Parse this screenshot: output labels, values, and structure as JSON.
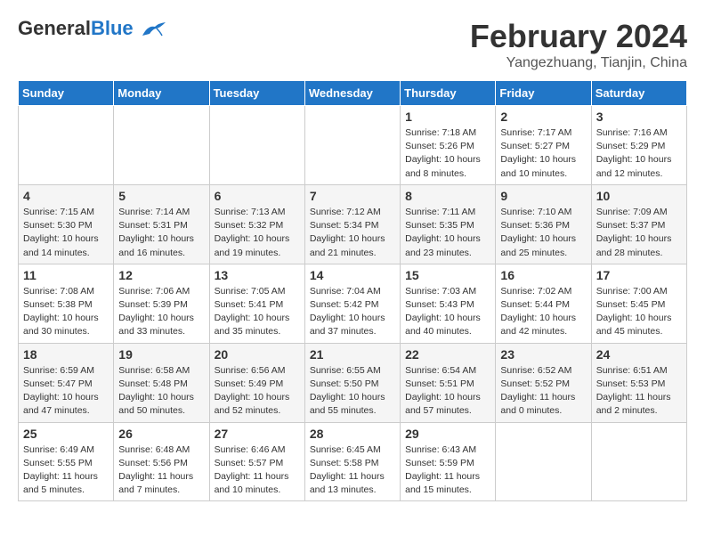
{
  "header": {
    "logo_line1": "General",
    "logo_line2": "Blue",
    "month_year": "February 2024",
    "location": "Yangezhuang, Tianjin, China"
  },
  "days_of_week": [
    "Sunday",
    "Monday",
    "Tuesday",
    "Wednesday",
    "Thursday",
    "Friday",
    "Saturday"
  ],
  "weeks": [
    [
      {
        "day": "",
        "info": ""
      },
      {
        "day": "",
        "info": ""
      },
      {
        "day": "",
        "info": ""
      },
      {
        "day": "",
        "info": ""
      },
      {
        "day": "1",
        "info": "Sunrise: 7:18 AM\nSunset: 5:26 PM\nDaylight: 10 hours\nand 8 minutes."
      },
      {
        "day": "2",
        "info": "Sunrise: 7:17 AM\nSunset: 5:27 PM\nDaylight: 10 hours\nand 10 minutes."
      },
      {
        "day": "3",
        "info": "Sunrise: 7:16 AM\nSunset: 5:29 PM\nDaylight: 10 hours\nand 12 minutes."
      }
    ],
    [
      {
        "day": "4",
        "info": "Sunrise: 7:15 AM\nSunset: 5:30 PM\nDaylight: 10 hours\nand 14 minutes."
      },
      {
        "day": "5",
        "info": "Sunrise: 7:14 AM\nSunset: 5:31 PM\nDaylight: 10 hours\nand 16 minutes."
      },
      {
        "day": "6",
        "info": "Sunrise: 7:13 AM\nSunset: 5:32 PM\nDaylight: 10 hours\nand 19 minutes."
      },
      {
        "day": "7",
        "info": "Sunrise: 7:12 AM\nSunset: 5:34 PM\nDaylight: 10 hours\nand 21 minutes."
      },
      {
        "day": "8",
        "info": "Sunrise: 7:11 AM\nSunset: 5:35 PM\nDaylight: 10 hours\nand 23 minutes."
      },
      {
        "day": "9",
        "info": "Sunrise: 7:10 AM\nSunset: 5:36 PM\nDaylight: 10 hours\nand 25 minutes."
      },
      {
        "day": "10",
        "info": "Sunrise: 7:09 AM\nSunset: 5:37 PM\nDaylight: 10 hours\nand 28 minutes."
      }
    ],
    [
      {
        "day": "11",
        "info": "Sunrise: 7:08 AM\nSunset: 5:38 PM\nDaylight: 10 hours\nand 30 minutes."
      },
      {
        "day": "12",
        "info": "Sunrise: 7:06 AM\nSunset: 5:39 PM\nDaylight: 10 hours\nand 33 minutes."
      },
      {
        "day": "13",
        "info": "Sunrise: 7:05 AM\nSunset: 5:41 PM\nDaylight: 10 hours\nand 35 minutes."
      },
      {
        "day": "14",
        "info": "Sunrise: 7:04 AM\nSunset: 5:42 PM\nDaylight: 10 hours\nand 37 minutes."
      },
      {
        "day": "15",
        "info": "Sunrise: 7:03 AM\nSunset: 5:43 PM\nDaylight: 10 hours\nand 40 minutes."
      },
      {
        "day": "16",
        "info": "Sunrise: 7:02 AM\nSunset: 5:44 PM\nDaylight: 10 hours\nand 42 minutes."
      },
      {
        "day": "17",
        "info": "Sunrise: 7:00 AM\nSunset: 5:45 PM\nDaylight: 10 hours\nand 45 minutes."
      }
    ],
    [
      {
        "day": "18",
        "info": "Sunrise: 6:59 AM\nSunset: 5:47 PM\nDaylight: 10 hours\nand 47 minutes."
      },
      {
        "day": "19",
        "info": "Sunrise: 6:58 AM\nSunset: 5:48 PM\nDaylight: 10 hours\nand 50 minutes."
      },
      {
        "day": "20",
        "info": "Sunrise: 6:56 AM\nSunset: 5:49 PM\nDaylight: 10 hours\nand 52 minutes."
      },
      {
        "day": "21",
        "info": "Sunrise: 6:55 AM\nSunset: 5:50 PM\nDaylight: 10 hours\nand 55 minutes."
      },
      {
        "day": "22",
        "info": "Sunrise: 6:54 AM\nSunset: 5:51 PM\nDaylight: 10 hours\nand 57 minutes."
      },
      {
        "day": "23",
        "info": "Sunrise: 6:52 AM\nSunset: 5:52 PM\nDaylight: 11 hours\nand 0 minutes."
      },
      {
        "day": "24",
        "info": "Sunrise: 6:51 AM\nSunset: 5:53 PM\nDaylight: 11 hours\nand 2 minutes."
      }
    ],
    [
      {
        "day": "25",
        "info": "Sunrise: 6:49 AM\nSunset: 5:55 PM\nDaylight: 11 hours\nand 5 minutes."
      },
      {
        "day": "26",
        "info": "Sunrise: 6:48 AM\nSunset: 5:56 PM\nDaylight: 11 hours\nand 7 minutes."
      },
      {
        "day": "27",
        "info": "Sunrise: 6:46 AM\nSunset: 5:57 PM\nDaylight: 11 hours\nand 10 minutes."
      },
      {
        "day": "28",
        "info": "Sunrise: 6:45 AM\nSunset: 5:58 PM\nDaylight: 11 hours\nand 13 minutes."
      },
      {
        "day": "29",
        "info": "Sunrise: 6:43 AM\nSunset: 5:59 PM\nDaylight: 11 hours\nand 15 minutes."
      },
      {
        "day": "",
        "info": ""
      },
      {
        "day": "",
        "info": ""
      }
    ]
  ]
}
